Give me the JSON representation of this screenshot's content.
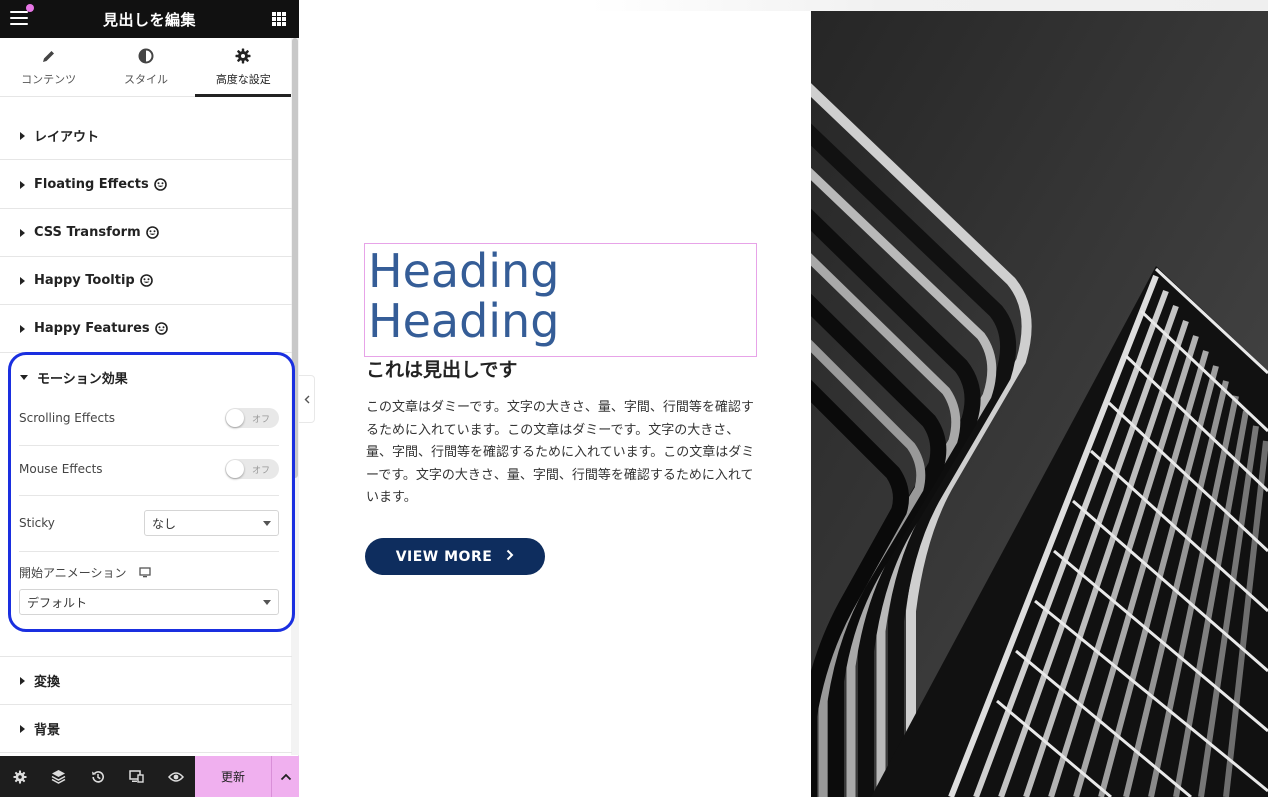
{
  "panel": {
    "title": "見出しを編集",
    "tabs": [
      {
        "label": "コンテンツ",
        "icon": "pencil-icon"
      },
      {
        "label": "スタイル",
        "icon": "half-circle-icon"
      },
      {
        "label": "高度な設定",
        "icon": "gear-icon",
        "active": true
      }
    ],
    "sections": [
      {
        "label": "レイアウト"
      },
      {
        "label": "Floating Effects",
        "badge": "happy-addons-icon"
      },
      {
        "label": "CSS Transform",
        "badge": "happy-addons-icon"
      },
      {
        "label": "Happy Tooltip",
        "badge": "happy-addons-icon"
      },
      {
        "label": "Happy Features",
        "badge": "happy-addons-icon"
      }
    ],
    "motion": {
      "label": "モーション効果",
      "scrolling_label": "Scrolling Effects",
      "scrolling_value": "オフ",
      "mouse_label": "Mouse Effects",
      "mouse_value": "オフ",
      "sticky_label": "Sticky",
      "sticky_value": "なし",
      "entrance_label": "開始アニメーション",
      "entrance_value": "デフォルト"
    },
    "sections_after": [
      {
        "label": "変換"
      },
      {
        "label": "背景"
      }
    ],
    "bottom": {
      "update_label": "更新"
    }
  },
  "canvas": {
    "heading": "Heading Heading",
    "subheading": "これは見出しです",
    "body": "この文章はダミーです。文字の大きさ、量、字間、行間等を確認するために入れています。この文章はダミーです。文字の大きさ、量、字間、行間等を確認するために入れています。この文章はダミーです。文字の大きさ、量、字間、行間等を確認するために入れています。",
    "button_label": "VIEW MORE"
  },
  "colors": {
    "accent_pink": "#f0b0ef",
    "highlight_blue": "#1a2fe0",
    "heading_blue": "#355d97",
    "button_navy": "#0e2d5e"
  }
}
